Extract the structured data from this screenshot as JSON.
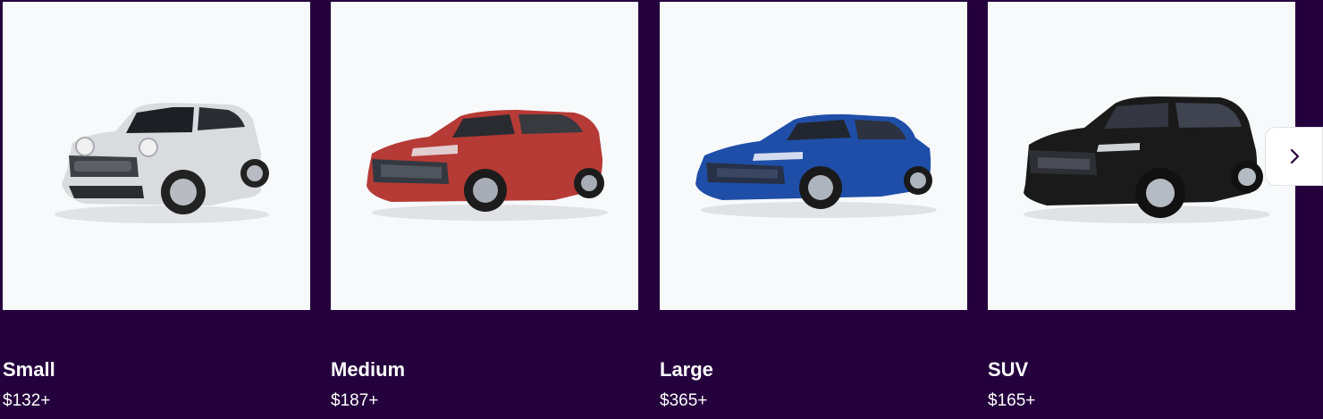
{
  "carousel": {
    "cards": [
      {
        "title": "Small",
        "price": "$132+",
        "car_color": "#d9dbde",
        "car_icon": "small-car-icon"
      },
      {
        "title": "Medium",
        "price": "$187+",
        "car_color": "#b63a35",
        "car_icon": "medium-car-icon"
      },
      {
        "title": "Large",
        "price": "$365+",
        "car_color": "#1f4ea8",
        "car_icon": "large-car-icon"
      },
      {
        "title": "SUV",
        "price": "$165+",
        "car_color": "#1a1a1a",
        "car_icon": "suv-icon"
      }
    ],
    "next_icon": "chevron-right-icon"
  },
  "colors": {
    "background": "#24003d",
    "card_background": "#f7f9fb",
    "text": "#ffffff"
  }
}
